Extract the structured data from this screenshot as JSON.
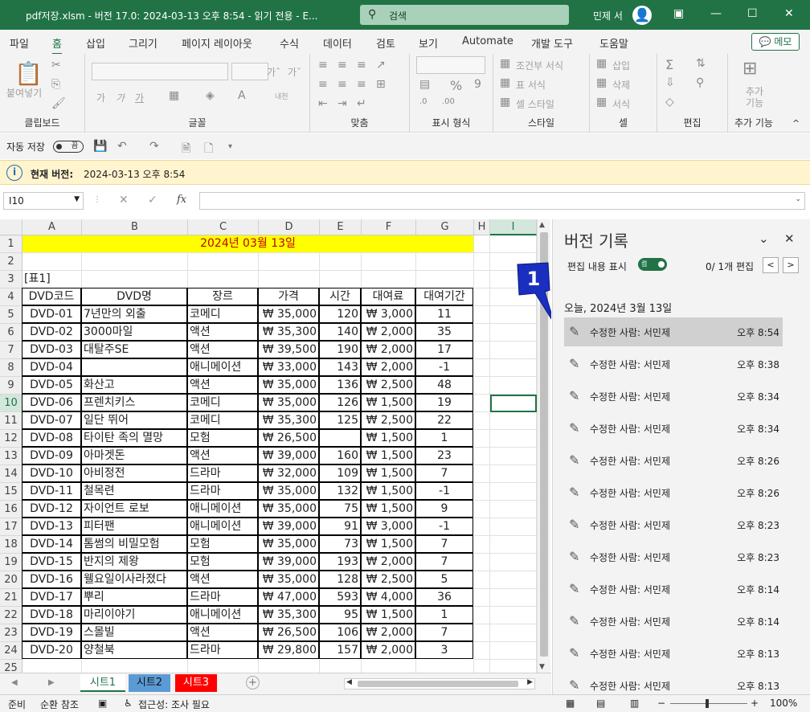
{
  "window": {
    "title": "pdf저장.xlsm  -  버전 17.0: 2024-03-13 오후 8:54  -  읽기 전용  -  E...",
    "search_placeholder": "검색",
    "user": "민제 서"
  },
  "menu": {
    "tabs": [
      "파일",
      "홈",
      "삽입",
      "그리기",
      "페이지 레이아웃",
      "수식",
      "데이터",
      "검토",
      "보기",
      "Automate",
      "개발 도구",
      "도움말"
    ],
    "active": "홈",
    "memo": "메모"
  },
  "ribbon": {
    "paste": "붙여넣기",
    "groups": [
      "클립보드",
      "글꼴",
      "맞춤",
      "표시 형식",
      "스타일",
      "셀",
      "편집",
      "추가 기능"
    ],
    "style_items": [
      "조건부 서식",
      "표 서식",
      "셀 스타일"
    ],
    "cell_items": [
      "삽입",
      "삭제",
      "서식"
    ],
    "addin_label": "추가\n기능",
    "font_buttons": [
      "가",
      "가",
      "가",
      "내천"
    ]
  },
  "qat": {
    "autosave": "자동 저장",
    "toggle_state": "끔"
  },
  "infobar": {
    "title": "현재 버전:",
    "text": "2024-03-13 오후 8:54"
  },
  "formula_bar": {
    "name_box": "I10",
    "fx": "fx"
  },
  "sheet": {
    "col_headers": [
      "A",
      "B",
      "C",
      "D",
      "E",
      "F",
      "G",
      "H",
      "I"
    ],
    "selected_col": "I",
    "selected_row": 10,
    "title_cell": "2024년 03월 13일",
    "table_label": "[표1]",
    "headers": [
      "DVD코드",
      "DVD명",
      "장르",
      "가격",
      "시간",
      "대여료",
      "대여기간"
    ],
    "rows": [
      [
        "DVD-01",
        "7년만의 외출",
        "코메디",
        "₩ 35,000",
        "120",
        "₩ 3,000",
        "11"
      ],
      [
        "DVD-02",
        "3000마일",
        "액션",
        "₩ 35,300",
        "140",
        "₩ 2,000",
        "35"
      ],
      [
        "DVD-03",
        "대탈주SE",
        "액션",
        "₩ 39,500",
        "190",
        "₩ 2,000",
        "17"
      ],
      [
        "DVD-04",
        "",
        "애니메이션",
        "₩ 33,000",
        "143",
        "₩ 2,000",
        "-1"
      ],
      [
        "DVD-05",
        "화산고",
        "액션",
        "₩ 35,000",
        "136",
        "₩ 2,500",
        "48"
      ],
      [
        "DVD-06",
        "프렌치키스",
        "코메디",
        "₩ 35,000",
        "126",
        "₩ 1,500",
        "19"
      ],
      [
        "DVD-07",
        "일단 뛰어",
        "코메디",
        "₩ 35,300",
        "125",
        "₩ 2,500",
        "22"
      ],
      [
        "DVD-08",
        "타이탄 족의 멸망",
        "모험",
        "₩ 26,500",
        "",
        "₩ 1,500",
        "1"
      ],
      [
        "DVD-09",
        "아마겟돈",
        "액션",
        "₩ 39,000",
        "160",
        "₩ 1,500",
        "23"
      ],
      [
        "DVD-10",
        "아비정전",
        "드라마",
        "₩ 32,000",
        "109",
        "₩ 1,500",
        "7"
      ],
      [
        "DVD-11",
        "철목련",
        "드라마",
        "₩ 35,000",
        "132",
        "₩ 1,500",
        "-1"
      ],
      [
        "DVD-12",
        "자이언트 로보",
        "애니메이션",
        "₩ 35,000",
        "75",
        "₩ 1,500",
        "9"
      ],
      [
        "DVD-13",
        "피터팬",
        "애니메이션",
        "₩ 39,000",
        "91",
        "₩ 3,000",
        "-1"
      ],
      [
        "DVD-14",
        "톰썸의 비밀모험",
        "모험",
        "₩ 35,000",
        "73",
        "₩ 1,500",
        "7"
      ],
      [
        "DVD-15",
        "반지의 제왕",
        "모험",
        "₩ 39,000",
        "193",
        "₩ 2,000",
        "7"
      ],
      [
        "DVD-16",
        "웰요일이사라졌다",
        "액션",
        "₩ 35,000",
        "128",
        "₩ 2,500",
        "5"
      ],
      [
        "DVD-17",
        "뿌리",
        "드라마",
        "₩ 47,000",
        "593",
        "₩ 4,000",
        "36"
      ],
      [
        "DVD-18",
        "마리이야기",
        "애니메이션",
        "₩ 35,300",
        "95",
        "₩ 1,500",
        "1"
      ],
      [
        "DVD-19",
        "스몰빌",
        "액션",
        "₩ 26,500",
        "106",
        "₩ 2,000",
        "7"
      ],
      [
        "DVD-20",
        "양철북",
        "드라마",
        "₩ 29,800",
        "157",
        "₩ 2,000",
        "3"
      ]
    ]
  },
  "sheet_tabs": [
    {
      "label": "시트1",
      "bg": "#ffffff",
      "color": "#217346",
      "active": true
    },
    {
      "label": "시트2",
      "bg": "#5b9bd5",
      "color": "#111111",
      "active": false
    },
    {
      "label": "시트3",
      "bg": "#ff0000",
      "color": "#ffffff",
      "active": false
    }
  ],
  "status": {
    "ready": "준비",
    "circular": "순환 참조",
    "accessibility": "접근성: 조사 필요",
    "zoom": "100%"
  },
  "version_pane": {
    "title": "버전 기록",
    "show_edits": "편집 내용 표시",
    "toggle_text": "켬",
    "count": "0/ 1개 편집",
    "date_header": "오늘, 2024년 3월 13일",
    "callout_number": "1",
    "items": [
      {
        "text": "수정한 사람: 서민제",
        "time": "오후 8:54",
        "selected": true
      },
      {
        "text": "수정한 사람: 서민제",
        "time": "오후 8:38"
      },
      {
        "text": "수정한 사람: 서민제",
        "time": "오후 8:34"
      },
      {
        "text": "수정한 사람: 서민제",
        "time": "오후 8:34"
      },
      {
        "text": "수정한 사람: 서민제",
        "time": "오후 8:26"
      },
      {
        "text": "수정한 사람: 서민제",
        "time": "오후 8:26"
      },
      {
        "text": "수정한 사람: 서민제",
        "time": "오후 8:23"
      },
      {
        "text": "수정한 사람: 서민제",
        "time": "오후 8:23"
      },
      {
        "text": "수정한 사람: 서민제",
        "time": "오후 8:14"
      },
      {
        "text": "수정한 사람: 서민제",
        "time": "오후 8:14"
      },
      {
        "text": "수정한 사람: 서민제",
        "time": "오후 8:13"
      },
      {
        "text": "수정한 사람: 서민제",
        "time": "오후 8:13"
      }
    ]
  },
  "colors": {
    "accent": "#217346",
    "title_fill": "#ffff00",
    "title_text": "#c00000",
    "callout": "#1a2fbf"
  }
}
